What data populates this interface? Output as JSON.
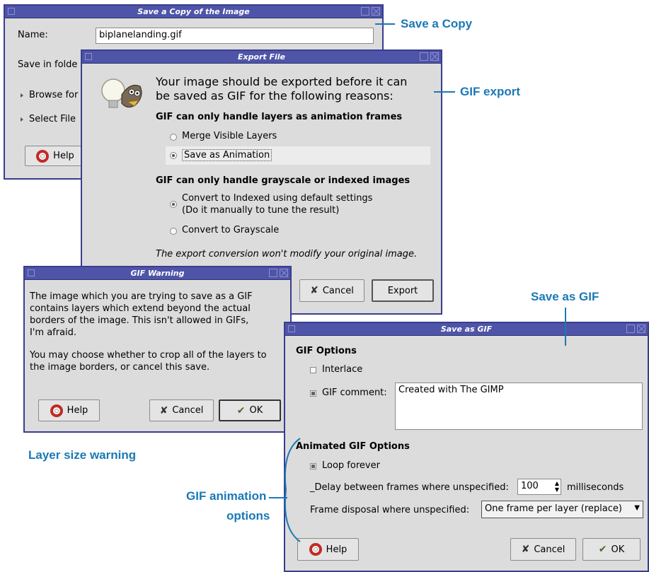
{
  "annotations": {
    "save_copy": "Save a Copy",
    "gif_export": "GIF export",
    "save_as_gif": "Save as GIF",
    "layer_size_warning": "Layer size warning",
    "gif_animation_options_line1": "GIF animation",
    "gif_animation_options_line2": "options"
  },
  "save_copy_dialog": {
    "title": "Save a Copy of the Image",
    "name_label": "Name:",
    "name_value": "biplanelanding.gif",
    "save_in_label": "Save in folde",
    "browse_label": "Browse for",
    "select_file_label": "Select File",
    "help_label": "Help"
  },
  "export_dialog": {
    "title": "Export File",
    "message_line1": "Your image should be exported before it can",
    "message_line2": "be saved as GIF for the following reasons:",
    "section1_title": "GIF can only handle layers as animation frames",
    "merge_visible_layers": "Merge Visible Layers",
    "save_as_animation": "Save as Animation",
    "section2_title": "GIF can only handle grayscale or indexed images",
    "convert_indexed_line1": "Convert to Indexed using default settings",
    "convert_indexed_line2": "(Do it manually to tune the result)",
    "convert_grayscale": "Convert to Grayscale",
    "footer_note": "The export conversion won't modify your original image.",
    "cancel_label": "Cancel",
    "export_label": "Export"
  },
  "gif_warning_dialog": {
    "title": "GIF Warning",
    "para1_line1": "The image which you are trying to save as a GIF",
    "para1_line2": "contains layers which extend beyond the actual",
    "para1_line3": "borders of the image.  This isn't allowed in GIFs,",
    "para1_line4": "I'm afraid.",
    "para2_line1": "You may choose whether to crop all of the layers to",
    "para2_line2": "the image borders, or cancel this save.",
    "help_label": "Help",
    "cancel_label": "Cancel",
    "ok_label": "OK"
  },
  "save_as_gif_dialog": {
    "title": "Save as GIF",
    "gif_options_title": "GIF Options",
    "interlace_label": "Interlace",
    "gif_comment_label": "GIF comment:",
    "gif_comment_value": "Created with The GIMP",
    "animated_title": "Animated GIF Options",
    "loop_forever_label": "Loop forever",
    "delay_label": "_Delay between frames where unspecified:",
    "delay_value": "100",
    "delay_unit": "milliseconds",
    "disposal_label": "Frame disposal where unspecified:",
    "disposal_value": "One frame per layer (replace)",
    "help_label": "Help",
    "cancel_label": "Cancel",
    "ok_label": "OK"
  },
  "colors": {
    "titlebar": "#4e55a8",
    "annotation": "#1a79b5",
    "dialog_bg": "#dcdcdc"
  }
}
